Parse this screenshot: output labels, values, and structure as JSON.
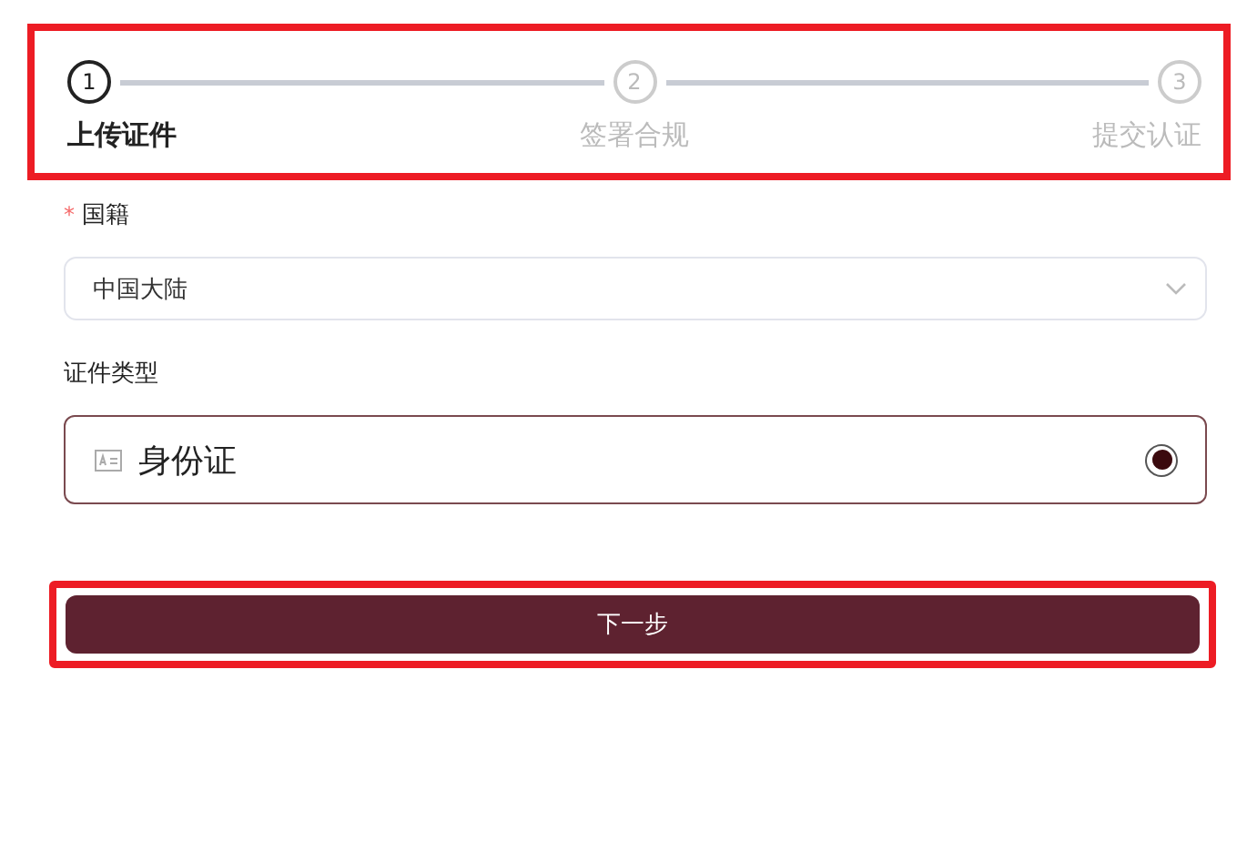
{
  "stepper": {
    "highlighted": true,
    "steps": [
      {
        "number": "1",
        "label": "上传证件",
        "selected": true
      },
      {
        "number": "2",
        "label": "签署合规",
        "selected": false
      },
      {
        "number": "3",
        "label": "提交认证",
        "selected": false
      }
    ]
  },
  "nationality": {
    "label": "国籍",
    "required_mark": "*",
    "value": "中国大陆"
  },
  "document_type": {
    "label": "证件类型",
    "options": [
      {
        "label": "身份证",
        "selected": true
      }
    ]
  },
  "next_button": {
    "label": "下一步",
    "highlighted": true
  }
}
